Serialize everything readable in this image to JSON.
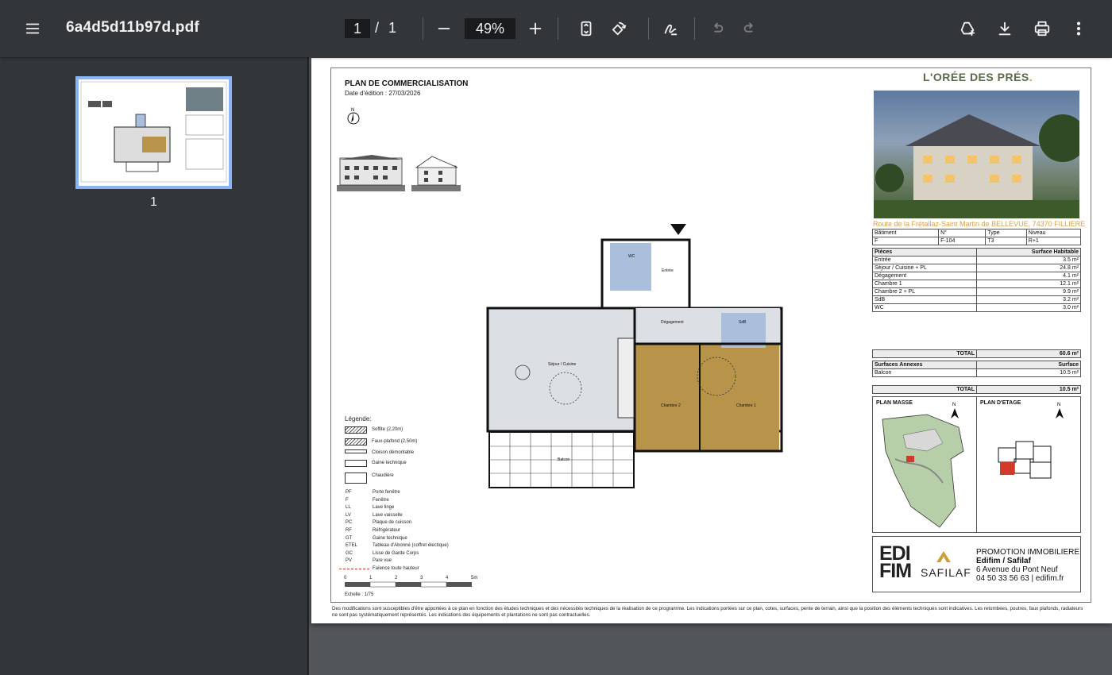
{
  "toolbar": {
    "filename": "6a4d5d11b97d.pdf",
    "current_page": "1",
    "page_separator": "/",
    "total_pages": "1",
    "zoom": "49%"
  },
  "sidebar": {
    "thumbnail_label": "1"
  },
  "document": {
    "title": "PLAN DE COMMERCIALISATION",
    "date_label": "Date d'édition :",
    "date_value": "27/03/2026",
    "brand": "L'ORÉE DES PRÉS",
    "brand_dot": ".",
    "address": "Route de la Frétallaz-Saint Martin de BELLEVUE, 74370 FILLIERE",
    "lot_headers": [
      "Bâtiment",
      "N°",
      "Type",
      "Niveau"
    ],
    "lot_values": [
      "F",
      "F-104",
      "T3",
      "R+1"
    ],
    "rooms_header": [
      "Pièces",
      "Surface Habitable"
    ],
    "rooms": [
      {
        "name": "Entrée",
        "area": "3.5 m²"
      },
      {
        "name": "Séjour / Cuisine + PL",
        "area": "24.8 m²"
      },
      {
        "name": "Dégagement",
        "area": "4.1 m²"
      },
      {
        "name": "Chambre 1",
        "area": "12.1 m²"
      },
      {
        "name": "Chambre 2 + PL",
        "area": "9.9 m²"
      },
      {
        "name": "SdB",
        "area": "3.2 m²"
      },
      {
        "name": "WC",
        "area": "3.0 m²"
      }
    ],
    "total_label": "TOTAL",
    "total_habitable": "60.6 m²",
    "annex_header": [
      "Surfaces Annexes",
      "Surface"
    ],
    "annex": [
      {
        "name": "Balcon",
        "area": "10.5 m²"
      }
    ],
    "total_annex": "10.5 m²",
    "plan_masse": "PLAN MASSE",
    "plan_etage": "PLAN D'ETAGE",
    "north": "N",
    "promo_line1": "PROMOTION IMMOBILIERE",
    "promo_line2": "Edifim / Safilaf",
    "promo_line3": "6 Avenue du Pont Neuf",
    "promo_line4": "04 50 33 56 63 | edifim.fr",
    "edi_logo_line1": "EDI",
    "edi_logo_line2": "FIM",
    "safilaf_logo": "SAFILAF",
    "legend_title": "Légende:",
    "legend_hatch": [
      "Soffite (2,20m)",
      "Faux-plafond (2,50m)",
      "Cloison démontable",
      "Gaine technique",
      "Chaudière"
    ],
    "legend_abbr": [
      {
        "code": "PF",
        "text": "Porte fenêtre"
      },
      {
        "code": "F",
        "text": "Fenêtre"
      },
      {
        "code": "LL",
        "text": "Lave linge"
      },
      {
        "code": "LV",
        "text": "Lave vaisselle"
      },
      {
        "code": "PC",
        "text": "Plaque de cuisson"
      },
      {
        "code": "RF",
        "text": "Réfrigérateur"
      },
      {
        "code": "GT",
        "text": "Gaine technique"
      },
      {
        "code": "ETEL",
        "text": "Tableau d'Abonné (coffret électique)"
      },
      {
        "code": "GC",
        "text": "Lisse de Garde Corps"
      },
      {
        "code": "PV",
        "text": "Pare vue"
      },
      {
        "code": "",
        "text": "Faïence toute hauteur"
      }
    ],
    "scale_ticks": [
      "0",
      "1",
      "2",
      "3",
      "4",
      "5m"
    ],
    "scale_label": "Echelle : 1/75",
    "room_labels": {
      "entree": "Entrée",
      "wc": "WC",
      "degagement": "Dégagement",
      "sdb": "SdB",
      "sejour": "Séjour / Cuisine",
      "chambre1": "Chambre 1",
      "chambre2": "Chambre 2",
      "balcon": "Balcon"
    },
    "footnote": "Des modifications sont susceptibles d'être apportées à ce plan en fonction des études techniques et des nécessités techniques de la réalisation de ce programme.   Les indications portées sur ce plan, cotes, surfaces, pente de terrain, ainsi que la position des éléments techniques sont indicatives.  Les retombées, poutres, faux plafonds, radiateurs ne sont pas systématiquement représentés. Les indications des équipements et plantations ne sont pas contractuelles."
  },
  "colors": {
    "toolbar_bg": "#323639",
    "viewer_bg": "#525659",
    "thumb_border": "#8ab4f8",
    "brand_gold": "#d4a24a",
    "bedroom_fill": "#b8944a",
    "wet_room_fill": "#a9bfdc",
    "living_fill": "#dcdfe3"
  },
  "icons": {
    "menu": "menu-icon",
    "zoom_out": "minus-icon",
    "zoom_in": "plus-icon",
    "fit": "fit-page-icon",
    "rotate": "rotate-icon",
    "annotate": "pen-icon",
    "undo": "undo-icon",
    "redo": "redo-icon",
    "drive": "drive-add-icon",
    "download": "download-icon",
    "print": "print-icon",
    "more": "more-vert-icon"
  }
}
